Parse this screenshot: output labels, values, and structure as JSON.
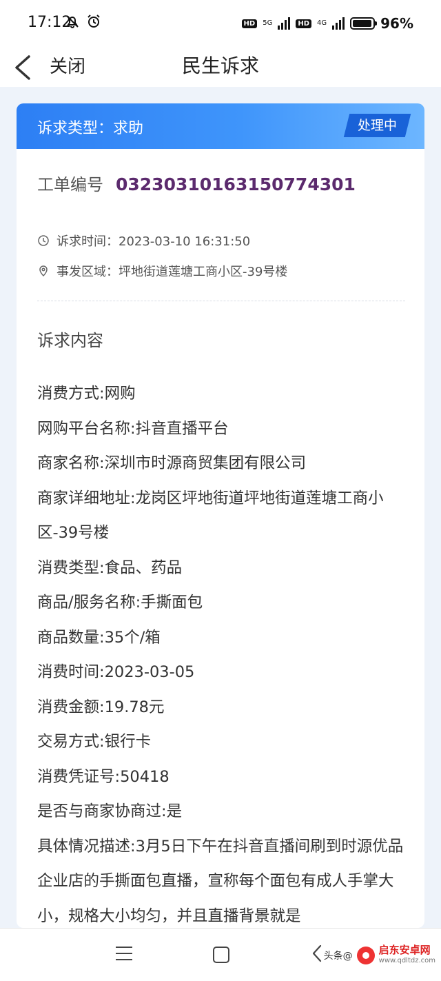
{
  "status_bar": {
    "time": "17:12",
    "left_icons": [
      "mute-bell-icon",
      "alarm-icon"
    ],
    "hd": "HD",
    "net1": "5G",
    "net2": "4G",
    "battery_level": 0.96,
    "battery_pct": "96%"
  },
  "nav": {
    "close_label": "关闭",
    "title": "民生诉求"
  },
  "card": {
    "header_label": "诉求类型：求助",
    "status": "处理中",
    "order_label": "工单编号",
    "order_no": "03230310163150774301",
    "time_row": "诉求时间：2023-03-10 16:31:50",
    "area_row": "事发区域：坪地街道莲塘工商小区-39号楼",
    "section_title": "诉求内容",
    "content_lines": [
      "消费方式:网购",
      "网购平台名称:抖音直播平台",
      "商家名称:深圳市时源商贸集团有限公司",
      "商家详细地址:龙岗区坪地街道坪地街道莲塘工商小区-39号楼",
      "消费类型:食品、药品",
      "商品/服务名称:手撕面包",
      "商品数量:35个/箱",
      "消费时间:2023-03-05",
      "消费金额:19.78元",
      "交易方式:银行卡",
      "消费凭证号:50418",
      "是否与商家协商过:是",
      "具体情况描述:3月5日下午在抖音直播间刷到时源优品企业店的手撕面包直播，宣称每个面包有成人手掌大小，规格大小均匀，并且直播背景就是"
    ]
  },
  "watermark": {
    "prefix": "头条@",
    "site": "启东安卓网",
    "url": "www.qdltdz.com"
  }
}
